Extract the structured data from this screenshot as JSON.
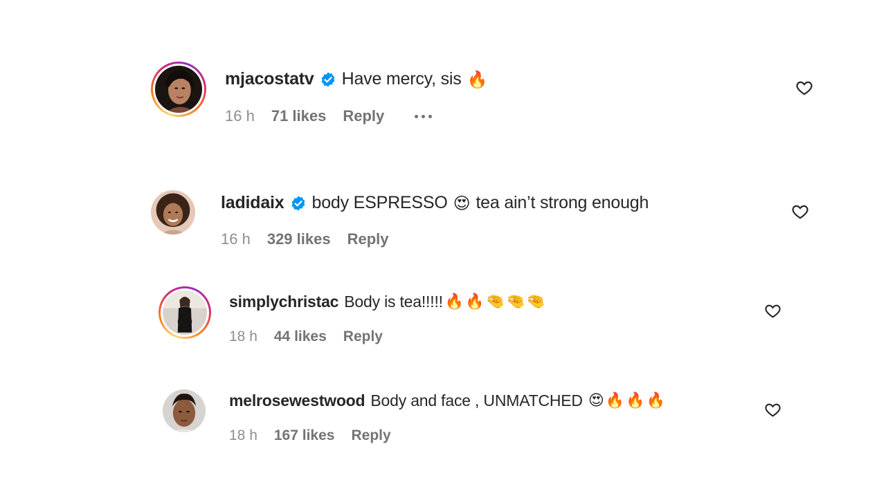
{
  "colors": {
    "text": "#262626",
    "meta": "#737373",
    "verified": "#0095f6",
    "story_ring": [
      "#feda75",
      "#fa7e1e",
      "#d62976",
      "#962fbf"
    ]
  },
  "comments": [
    {
      "username": "mjacostatv",
      "verified": true,
      "text": "Have mercy, sis",
      "emojis": "🔥",
      "time": "16 h",
      "likes": "71 likes",
      "reply": "Reply",
      "has_more_menu": true,
      "has_story_ring": true,
      "icon": "heart-outline-icon"
    },
    {
      "username": "ladidaix",
      "verified": true,
      "text": "body ESPRESSO",
      "emoji_mid": "😍",
      "text_after": "tea ain’t strong enough",
      "time": "16 h",
      "likes": "329 likes",
      "reply": "Reply",
      "has_story_ring": false,
      "icon": "heart-outline-icon"
    },
    {
      "username": "simplychristac",
      "verified": false,
      "text": "Body is tea!!!!!",
      "emojis": "🔥🔥🤏🤏🤏",
      "time": "18 h",
      "likes": "44 likes",
      "reply": "Reply",
      "has_story_ring": true,
      "icon": "heart-outline-icon"
    },
    {
      "username": "melrosewestwood",
      "verified": false,
      "text": "Body and face , UNMATCHED",
      "emojis": "😍🔥🔥🔥",
      "time": "18 h",
      "likes": "167 likes",
      "reply": "Reply",
      "has_story_ring": false,
      "icon": "heart-outline-icon"
    }
  ]
}
